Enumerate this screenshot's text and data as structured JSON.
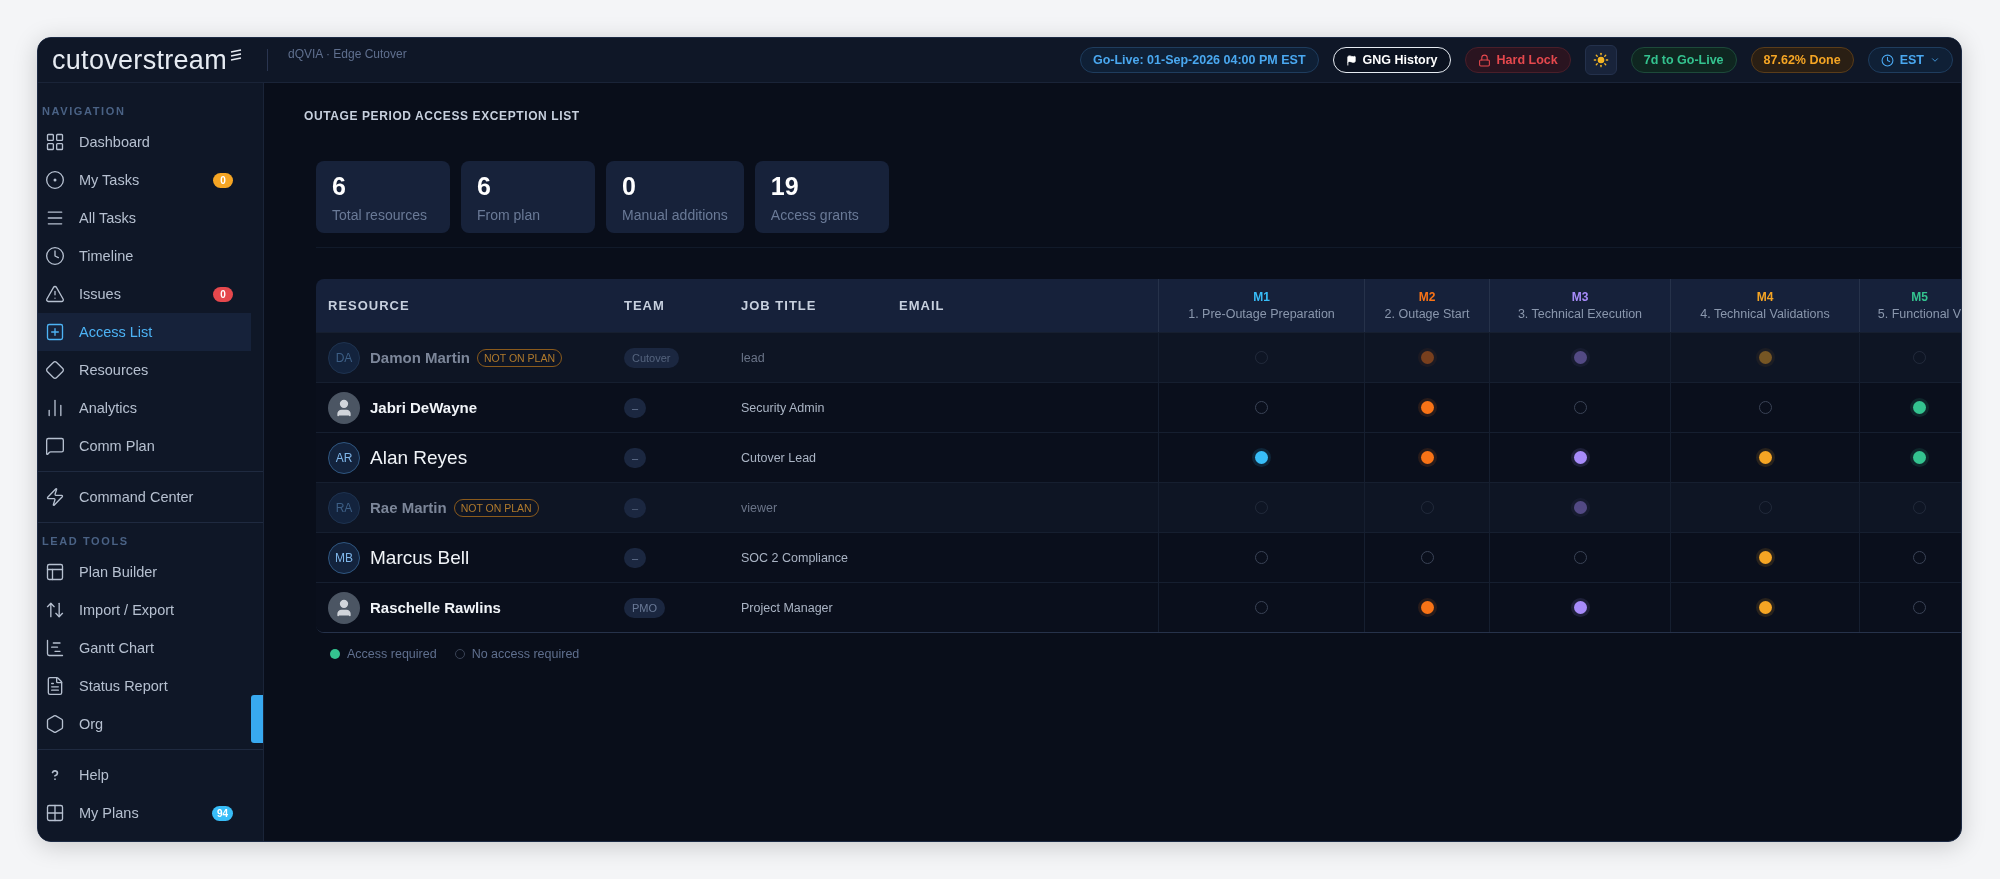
{
  "header": {
    "logo": "cutoverstream",
    "project": "dQVIA · Edge Cutover",
    "go_live": "Go-Live: 01-Sep-2026 04:00 PM EST",
    "history_button": "GNG History",
    "lock_label": "Hard Lock",
    "countdown": "7d to Go-Live",
    "progress": "87.62% Done",
    "timezone": "EST"
  },
  "sidebar": {
    "sections": [
      {
        "title": "NAVIGATION",
        "items": [
          {
            "label": "Dashboard",
            "selected": false
          },
          {
            "label": "My Tasks",
            "selected": false,
            "badge": "0",
            "color": "#f5a524"
          },
          {
            "label": "All Tasks",
            "selected": false
          },
          {
            "label": "Timeline",
            "selected": false
          },
          {
            "label": "Issues",
            "selected": false,
            "badge": "0",
            "color": "#e5484d"
          },
          {
            "label": "Access List",
            "selected": true
          },
          {
            "label": "Resources",
            "selected": false
          },
          {
            "label": "Analytics",
            "selected": false
          },
          {
            "label": "Comm Plan",
            "selected": false
          }
        ]
      },
      {
        "items": [
          {
            "label": "Command Center",
            "selected": false
          }
        ]
      },
      {
        "title": "LEAD TOOLS",
        "items": [
          {
            "label": "Plan Builder",
            "selected": false
          },
          {
            "label": "Import / Export",
            "selected": false
          },
          {
            "label": "Gantt Chart",
            "selected": false
          },
          {
            "label": "Status Report",
            "selected": false
          },
          {
            "label": "Org",
            "selected": false
          }
        ]
      },
      {
        "items": [
          {
            "label": "Help",
            "selected": false
          },
          {
            "label": "My Plans",
            "selected": false,
            "badge": "94",
            "color": "#38bdf8"
          }
        ]
      }
    ]
  },
  "page": {
    "title": "OUTAGE PERIOD ACCESS EXCEPTION LIST",
    "stats": [
      {
        "value": "6",
        "label": "Total resources"
      },
      {
        "value": "6",
        "label": "From plan"
      },
      {
        "value": "0",
        "label": "Manual additions"
      },
      {
        "value": "19",
        "label": "Access grants"
      }
    ],
    "table": {
      "columns": [
        "RESOURCE",
        "TEAM",
        "JOB TITLE",
        "EMAIL"
      ],
      "milestones": [
        {
          "code": "M1",
          "name": "1. Pre-Outage Preparation",
          "color": "#38bdf8"
        },
        {
          "code": "M2",
          "name": "2. Outage Start",
          "color": "#f97316"
        },
        {
          "code": "M3",
          "name": "3. Technical Execution",
          "color": "#a78bfa"
        },
        {
          "code": "M4",
          "name": "4. Technical Validations",
          "color": "#f5a524"
        },
        {
          "code": "M5",
          "name": "5. Functional V",
          "color": "#34c38f"
        }
      ],
      "rows": [
        {
          "name": "Damon Martin",
          "avatar": {
            "kind": "initials",
            "initials": "DA"
          },
          "not_on_plan": true,
          "tag": "NOT ON PLAN",
          "team": "Cutover",
          "job_title": "lead",
          "access": [
            false,
            true,
            true,
            true,
            false
          ]
        },
        {
          "name": "Jabri DeWayne",
          "avatar": {
            "kind": "photo"
          },
          "not_on_plan": false,
          "team": "–",
          "job_title": "Security Admin",
          "access": [
            false,
            true,
            false,
            false,
            true
          ]
        },
        {
          "name": "Alan Reyes",
          "avatar": {
            "kind": "initials",
            "initials": "AR"
          },
          "not_on_plan": false,
          "team": "–",
          "job_title": "Cutover Lead",
          "access": [
            true,
            true,
            true,
            true,
            true
          ]
        },
        {
          "name": "Rae Martin",
          "avatar": {
            "kind": "initials",
            "initials": "RA"
          },
          "not_on_plan": true,
          "tag": "NOT ON PLAN",
          "team": "–",
          "job_title": "viewer",
          "access": [
            false,
            false,
            true,
            false,
            false
          ]
        },
        {
          "name": "Marcus Bell",
          "avatar": {
            "kind": "initials",
            "initials": "MB"
          },
          "not_on_plan": false,
          "team": "–",
          "job_title": "SOC 2 Compliance",
          "access": [
            false,
            false,
            false,
            true,
            false
          ]
        },
        {
          "name": "Raschelle Rawlins",
          "avatar": {
            "kind": "photo"
          },
          "not_on_plan": false,
          "team": "PMO",
          "job_title": "Project Manager",
          "access": [
            false,
            true,
            true,
            true,
            false
          ]
        }
      ]
    },
    "legend": [
      {
        "kind": "required",
        "label": "Access required"
      },
      {
        "kind": "none",
        "label": "No access required"
      }
    ]
  }
}
